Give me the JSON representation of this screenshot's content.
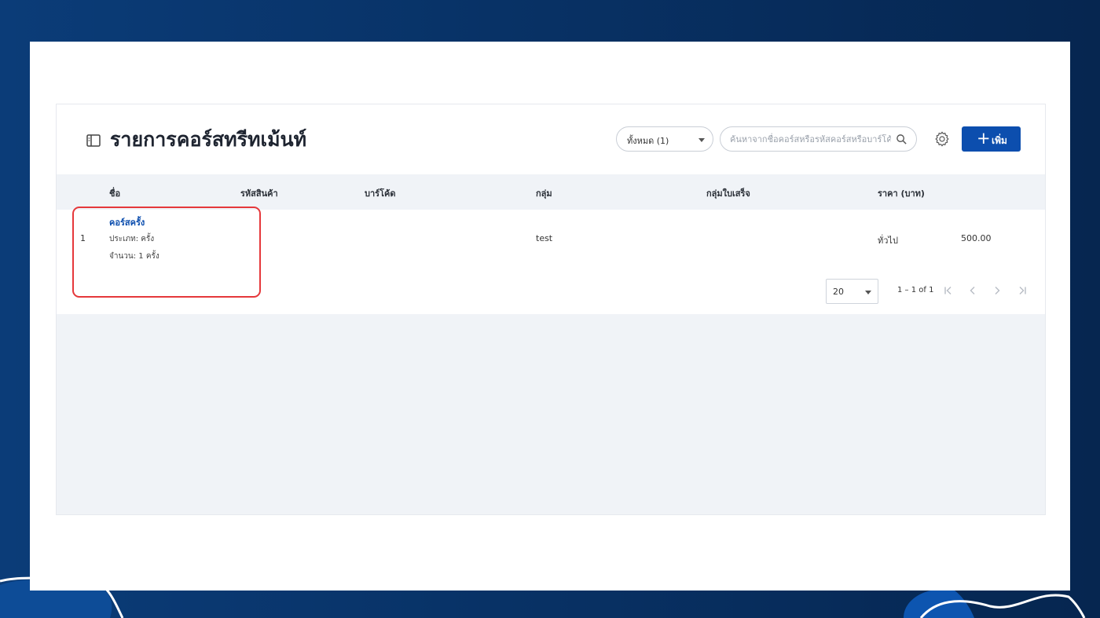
{
  "colors": {
    "accent": "#0c4eae",
    "highlight": "#e5383b",
    "background": "#083266"
  },
  "header": {
    "title": "รายการคอร์สทรีทเม้นท์",
    "title_icon": "book-icon",
    "filter": {
      "selected": "ทั้งหมด (1)"
    },
    "search": {
      "placeholder": "ค้นหาจากชื่อคอร์สหรือรหัสคอร์สหรือบาร์โค้ด",
      "value": ""
    },
    "settings_icon": "gear-icon",
    "add_button": {
      "icon": "plus-icon",
      "label": "เพิ่ม"
    }
  },
  "table": {
    "columns": [
      "ชื่อ",
      "รหัสสินค้า",
      "บาร์โค้ด",
      "กลุ่ม",
      "กลุ่มใบเสร็จ",
      "ราคา (บาท)"
    ],
    "rows": [
      {
        "index": "1",
        "name": "คอร์สครั้ง",
        "type_line": "ประเภท: ครั้ง",
        "amount_line": "จำนวน:  1 ครั้ง",
        "sku": "",
        "barcode": "",
        "group": "test",
        "receipt_group": "",
        "price_type": "ทั่วไป",
        "price": "500.00"
      }
    ]
  },
  "pagination": {
    "per_page": "20",
    "range": "1 – 1 of 1",
    "icons": [
      "first-page-icon",
      "prev-page-icon",
      "next-page-icon",
      "last-page-icon"
    ]
  }
}
